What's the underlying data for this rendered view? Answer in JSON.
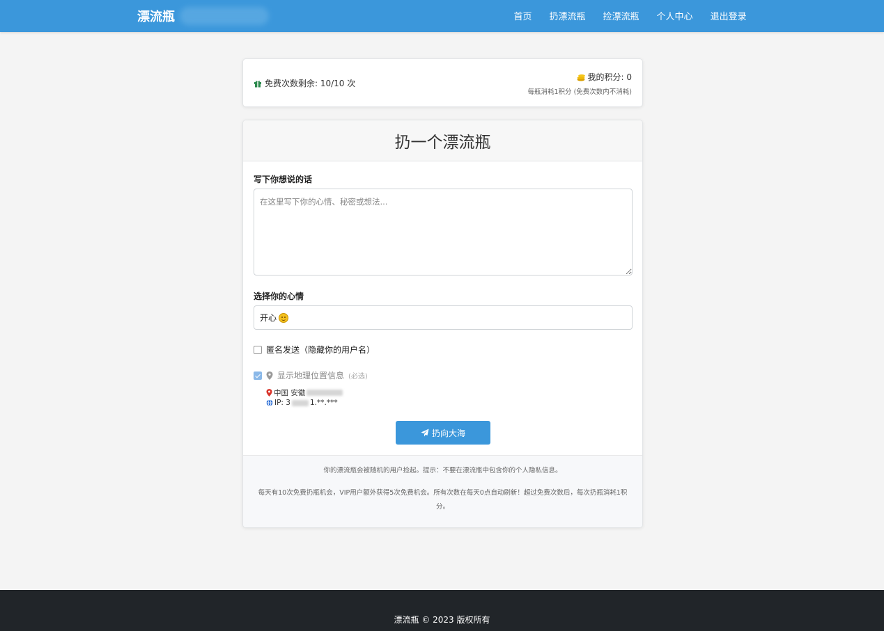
{
  "navbar": {
    "brand": "漂流瓶",
    "links": [
      "首页",
      "扔漂流瓶",
      "捡漂流瓶",
      "个人中心",
      "退出登录"
    ],
    "color": "#3b97db"
  },
  "stats": {
    "free_count": "免费次数剩余: 10/10 次",
    "points": "我的积分: 0",
    "points_note": "每瓶消耗1积分 (免费次数内不消耗)"
  },
  "form": {
    "title": "扔一个漂流瓶",
    "message_label": "写下你想说的话",
    "message_placeholder": "在这里写下你的心情、秘密或想法...",
    "mood_label": "选择你的心情",
    "mood_value": "开心",
    "mood_icon": "smile-emoji",
    "anonymous_label": "匿名发送（隐藏你的用户名）",
    "anonymous_checked": false,
    "location_label": "显示地理位置信息",
    "location_note": "(必选)",
    "location_checked": true,
    "location_text": "中国 安徽",
    "ip_prefix": "IP: 3",
    "ip_suffix": "1.**.***",
    "submit_label": "扔向大海"
  },
  "footer_notes": {
    "line1": "你的漂流瓶会被随机的用户捡起。提示：不要在漂流瓶中包含你的个人隐私信息。",
    "line2": "每天有10次免费扔瓶机会，VIP用户额外获得5次免费机会。所有次数在每天0点自动刷新！超过免费次数后，每次扔瓶消耗1积分。"
  },
  "site_footer": {
    "copyright": "漂流瓶 © 2023 版权所有"
  }
}
